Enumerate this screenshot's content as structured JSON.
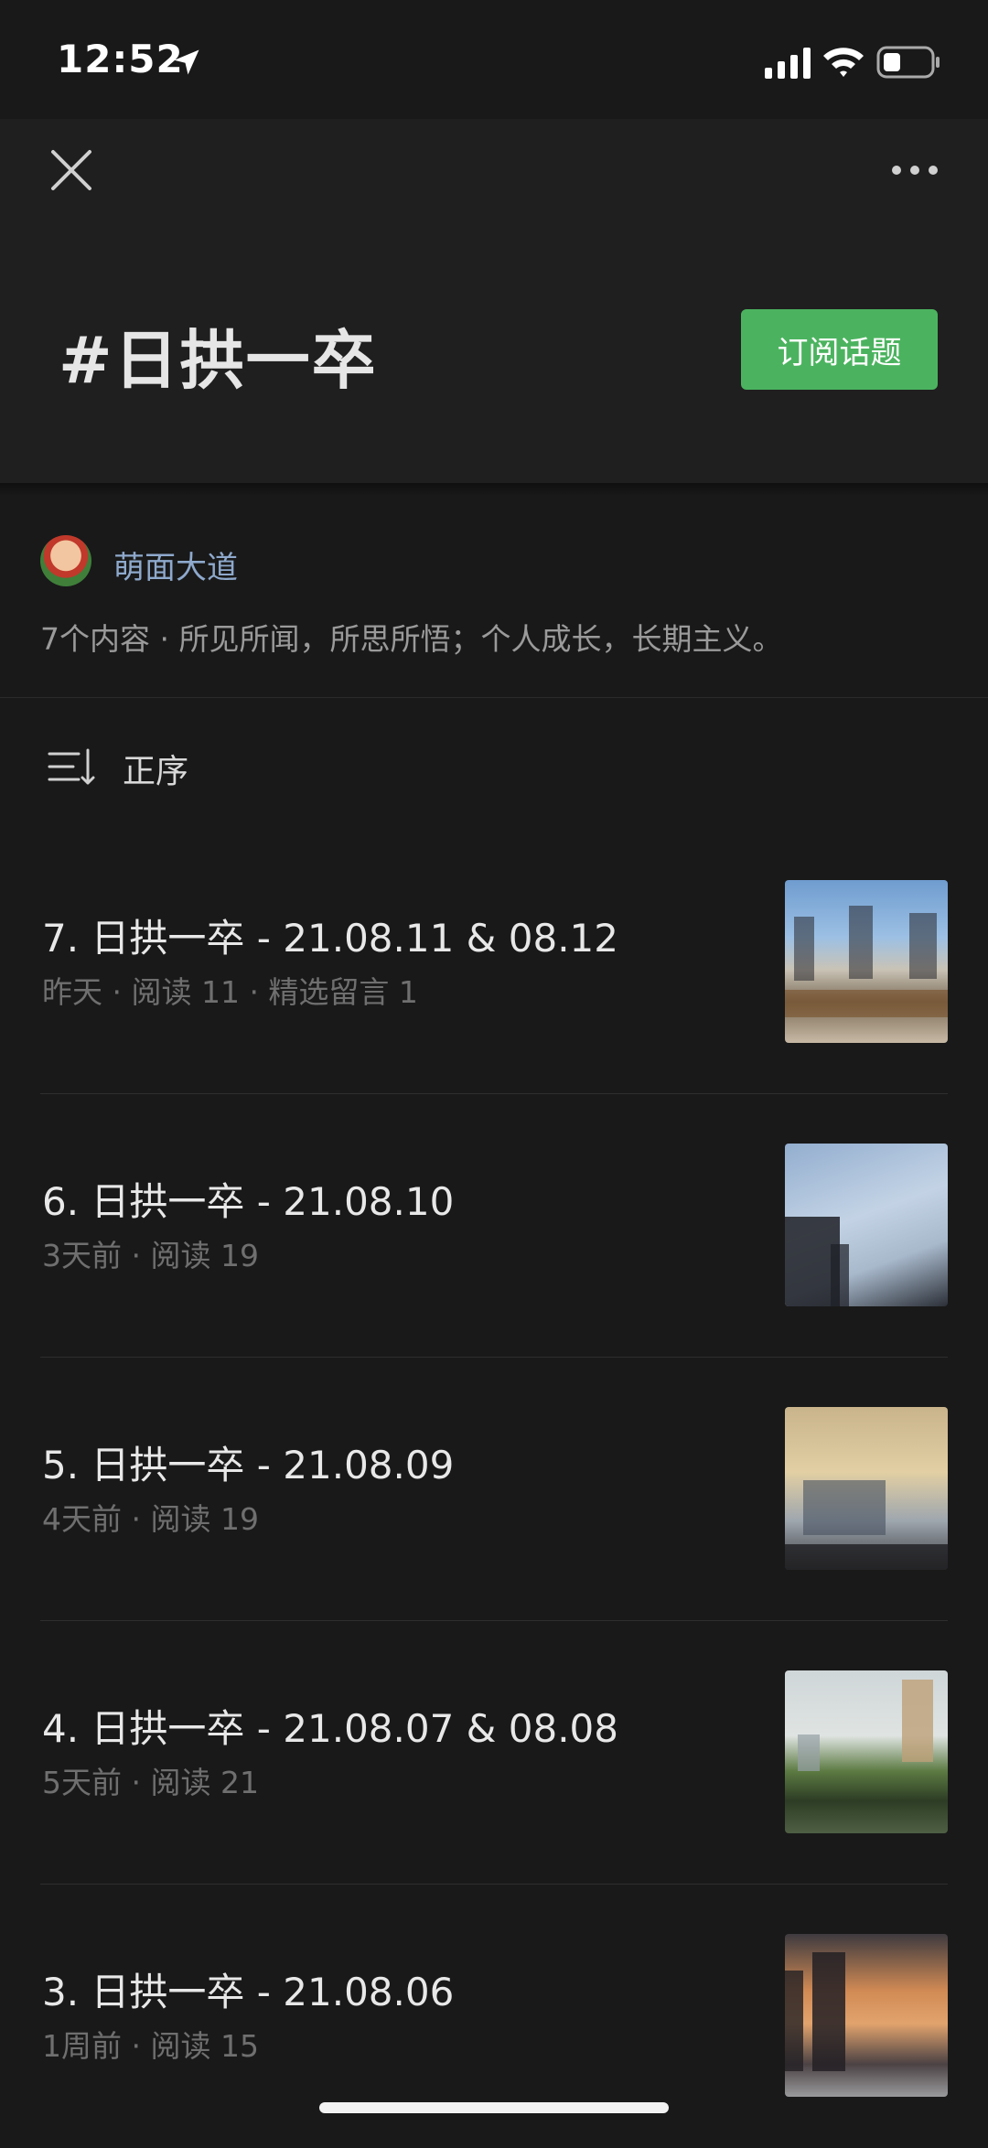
{
  "status_bar": {
    "time": "12:52",
    "icons": [
      "location-arrow-icon",
      "cellular-signal-icon",
      "wifi-icon",
      "battery-icon"
    ]
  },
  "header": {
    "title": "#日拱一卒",
    "subscribe_label": "订阅话题",
    "subscribe_color": "#4bb35f",
    "icons": [
      "close-icon",
      "more-icon"
    ]
  },
  "author": {
    "name": "萌面大道",
    "name_color": "#8ea9cc"
  },
  "description": "7个内容 · 所见所闻，所思所悟；个人成长，长期主义。",
  "sort": {
    "label": "正序",
    "icon": "sort-icon"
  },
  "articles": [
    {
      "title": "7. 日拱一卒 - 21.08.11 & 08.12",
      "meta": "昨天 · 阅读 11 · 精选留言 1"
    },
    {
      "title": "6. 日拱一卒 - 21.08.10",
      "meta": "3天前 · 阅读 19"
    },
    {
      "title": "5. 日拱一卒 - 21.08.09",
      "meta": "4天前 · 阅读 19"
    },
    {
      "title": "4. 日拱一卒 - 21.08.07 & 08.08",
      "meta": "5天前 · 阅读 21"
    },
    {
      "title": "3. 日拱一卒 - 21.08.06",
      "meta": "1周前 · 阅读 15"
    }
  ]
}
